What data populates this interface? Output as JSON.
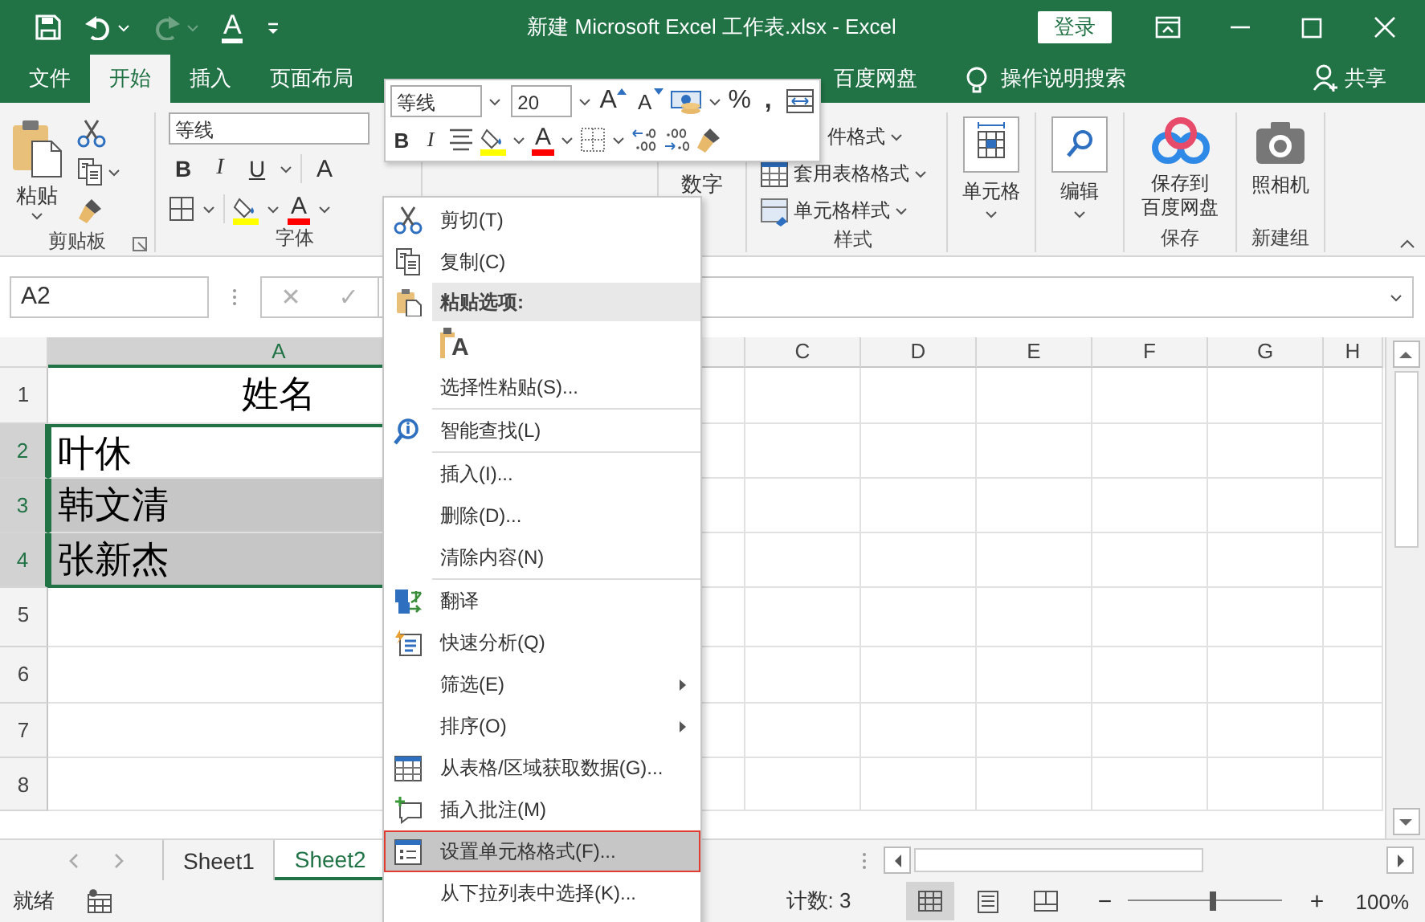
{
  "window": {
    "title": "新建 Microsoft Excel 工作表.xlsx  -  Excel",
    "sign_in": "登录"
  },
  "quick_access": {
    "redo_disabled": true,
    "font_color": "A"
  },
  "tabs": [
    {
      "label": "文件",
      "selected": false
    },
    {
      "label": "开始",
      "selected": true
    },
    {
      "label": "插入",
      "selected": false
    },
    {
      "label": "页面布局",
      "selected": false
    },
    {
      "kind": "covered"
    },
    {
      "kind": "covered"
    },
    {
      "kind": "covered"
    },
    {
      "kind": "covered"
    },
    {
      "kind": "covered"
    },
    {
      "label": "百度网盘",
      "selected": false
    }
  ],
  "tell_me": "操作说明搜索",
  "share": "共享",
  "ribbon": {
    "clipboard": {
      "paste": "粘贴",
      "label": "剪贴板"
    },
    "font": {
      "font_name": "等线",
      "bold": "B",
      "italic": "I",
      "underline": "U",
      "grow": "A",
      "font_color": "A",
      "label": "字体"
    },
    "number": {
      "button": "数字"
    },
    "styles": {
      "items": [
        {
          "kind": "partial",
          "label": "件格式"
        },
        {
          "kind": "full",
          "label": "套用表格格式"
        },
        {
          "kind": "full",
          "label": "单元格样式"
        }
      ],
      "label": "样式"
    },
    "cells": {
      "button": "单元格"
    },
    "editing": {
      "button": "编辑"
    },
    "save": {
      "button": "保存到百度网盘",
      "label": "保存"
    },
    "new_group": {
      "button": "照相机",
      "label": "新建组"
    }
  },
  "mini_toolbar": {
    "font_name": "等线",
    "font_size": "20",
    "grow": "A",
    "shrink": "A",
    "percent": "%",
    "comma": ",",
    "bold": "B",
    "italic": "I",
    "font_color": "A"
  },
  "formula_bar": {
    "name_box": "A2",
    "cancel": "✕",
    "enter": "✓",
    "disabled": true
  },
  "columns": [
    {
      "label": "A",
      "selected": true
    },
    {
      "selected": false
    },
    {
      "label": "C",
      "selected": false
    },
    {
      "label": "D",
      "selected": false
    },
    {
      "label": "E",
      "selected": false
    },
    {
      "label": "F",
      "selected": false
    },
    {
      "label": "G",
      "selected": false
    },
    {
      "label": "H",
      "selected": false
    }
  ],
  "rows": [
    {
      "header": "1",
      "selected": false,
      "cell": "姓名",
      "kind": "title"
    },
    {
      "header": "2",
      "selected": true,
      "cell": "叶休",
      "active": true
    },
    {
      "header": "3",
      "selected": true,
      "cell": "韩文清",
      "active": false
    },
    {
      "header": "4",
      "selected": true,
      "cell": "张新杰",
      "active": false
    },
    {
      "header": "5",
      "selected": false
    },
    {
      "header": "6",
      "selected": false
    },
    {
      "header": "7",
      "selected": false
    },
    {
      "header": "8",
      "selected": false
    }
  ],
  "sheets": [
    {
      "name": "Sheet1",
      "selected": false
    },
    {
      "name": "Sheet2",
      "selected": true
    }
  ],
  "status_bar": {
    "ready": "就绪",
    "count": "计数: 3",
    "views": [
      {
        "selected": true
      },
      {
        "selected": false
      },
      {
        "selected": false
      }
    ],
    "zoom_out": "−",
    "zoom_in": "+",
    "zoom": {
      "level": 0.55,
      "reading": "100%"
    }
  },
  "context_menu": [
    {
      "kind": "item",
      "label": "剪切(T)",
      "selected": false
    },
    {
      "kind": "item",
      "label": "复制(C)",
      "selected": false
    },
    {
      "kind": "header",
      "label": "粘贴选项:"
    },
    {
      "kind": "paste_options",
      "glyph": "A"
    },
    {
      "kind": "item",
      "label": "选择性粘贴(S)...",
      "selected": false
    },
    {
      "kind": "separator"
    },
    {
      "kind": "item",
      "label": "智能查找(L)",
      "selected": false
    },
    {
      "kind": "separator"
    },
    {
      "kind": "item",
      "label": "插入(I)...",
      "selected": false
    },
    {
      "kind": "item",
      "label": "删除(D)...",
      "selected": false
    },
    {
      "kind": "item",
      "label": "清除内容(N)",
      "selected": false
    },
    {
      "kind": "separator"
    },
    {
      "kind": "item",
      "label": "翻译",
      "selected": false
    },
    {
      "kind": "item",
      "label": "快速分析(Q)",
      "selected": false
    },
    {
      "kind": "submenu",
      "label": "筛选(E)",
      "selected": false
    },
    {
      "kind": "submenu",
      "label": "排序(O)",
      "selected": false
    },
    {
      "kind": "item",
      "label": "从表格/区域获取数据(G)...",
      "selected": false
    },
    {
      "kind": "item",
      "label": "插入批注(M)",
      "selected": false
    },
    {
      "kind": "item",
      "label": "设置单元格格式(F)...",
      "selected": true
    },
    {
      "kind": "item",
      "label": "从下拉列表中选择(K)...",
      "selected": false
    }
  ]
}
